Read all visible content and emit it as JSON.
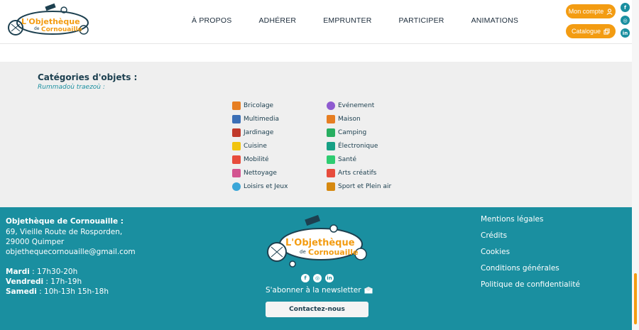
{
  "header": {
    "logo_text_top": "L'Objethèque",
    "logo_text_de": "de",
    "logo_text_bottom": "Cornouaille",
    "nav": [
      "À PROPOS",
      "ADHÉRER",
      "EMPRUNTER",
      "PARTICIPER",
      "ANIMATIONS"
    ],
    "account_label": "Mon compte",
    "catalogue_label": "Catalogue",
    "social": [
      "f",
      "◎",
      "in"
    ]
  },
  "categories": {
    "title": "Catégories d'objets :",
    "subtitle": "Rummadoù traezoù :",
    "column1": [
      {
        "label": "Bricolage",
        "color": "#e67e22"
      },
      {
        "label": "Multimedia",
        "color": "#3b6fb6"
      },
      {
        "label": "Jardinage",
        "color": "#c0392b"
      },
      {
        "label": "Cuisine",
        "color": "#f1c40f"
      },
      {
        "label": "Mobilité",
        "color": "#e74c3c"
      },
      {
        "label": "Nettoyage",
        "color": "#d35490"
      },
      {
        "label": "Loisirs et Jeux",
        "color": "#3aa6d8"
      }
    ],
    "column2": [
      {
        "label": "Evénement",
        "color": "#8e5bd0"
      },
      {
        "label": "Maison",
        "color": "#e67e22"
      },
      {
        "label": "Camping",
        "color": "#27ae60"
      },
      {
        "label": "Électronique",
        "color": "#16a085"
      },
      {
        "label": "Santé",
        "color": "#2ecc71"
      },
      {
        "label": "Arts créatifs",
        "color": "#e74c3c"
      },
      {
        "label": "Sport et Plein air",
        "color": "#d68910"
      }
    ]
  },
  "footer": {
    "org_name": "Objethèque de Cornouaille :",
    "address_line1": "69, Vieille Route de Rosporden,",
    "address_line2": "29000 Quimper",
    "email": "objethequecornouaille@gmail.com",
    "hours": [
      {
        "day": "Mardi",
        "time": " : 17h30-20h"
      },
      {
        "day": "Vendredi",
        "time": " : 17h-19h"
      },
      {
        "day": "Samedi",
        "time": " : 10h-13h 15h-18h"
      }
    ],
    "social": [
      "f",
      "◎",
      "in"
    ],
    "newsletter_label": "S'abonner à la newsletter",
    "contact_label": "Contactez-nous",
    "links": [
      "Mentions légales",
      "Crédits",
      "Cookies",
      "Conditions générales",
      "Politique de confidentialité"
    ]
  },
  "colors": {
    "teal": "#1a8fa0",
    "orange": "#f39c12",
    "dark": "#1d4050"
  }
}
